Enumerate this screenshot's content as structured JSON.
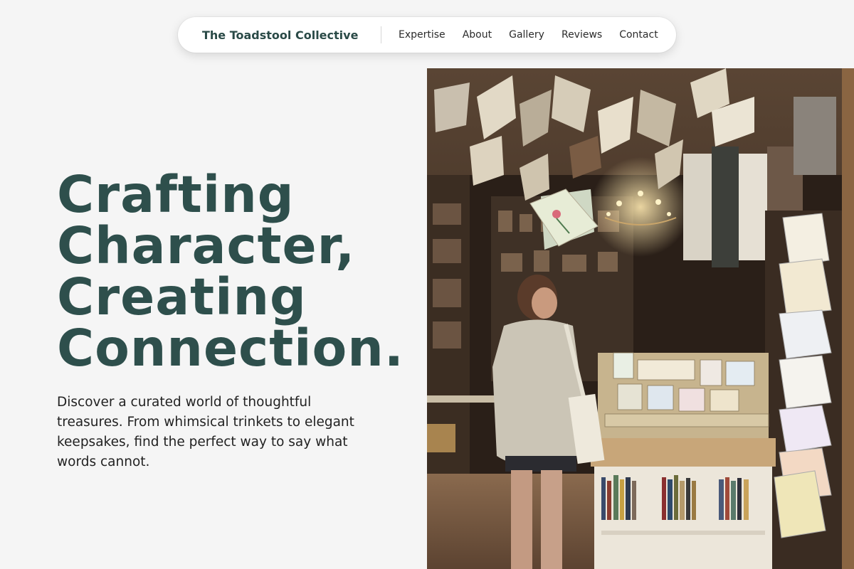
{
  "nav": {
    "brand": "The Toadstool Collective",
    "links": [
      "Expertise",
      "About",
      "Gallery",
      "Reviews",
      "Contact"
    ]
  },
  "hero": {
    "title_lines": [
      "Crafting",
      "Character,",
      "Creating",
      "Connection."
    ],
    "description": "Discover a curated world of thoughtful treasures. From whimsical trinkets to elegant keepsakes, find the perfect way to say what words cannot."
  },
  "image": {
    "subject": "bookshop-interior-photo"
  },
  "colors": {
    "background": "#f5f5f5",
    "brand": "#2a4a47",
    "title": "#2e4f4c",
    "text": "#222222"
  }
}
